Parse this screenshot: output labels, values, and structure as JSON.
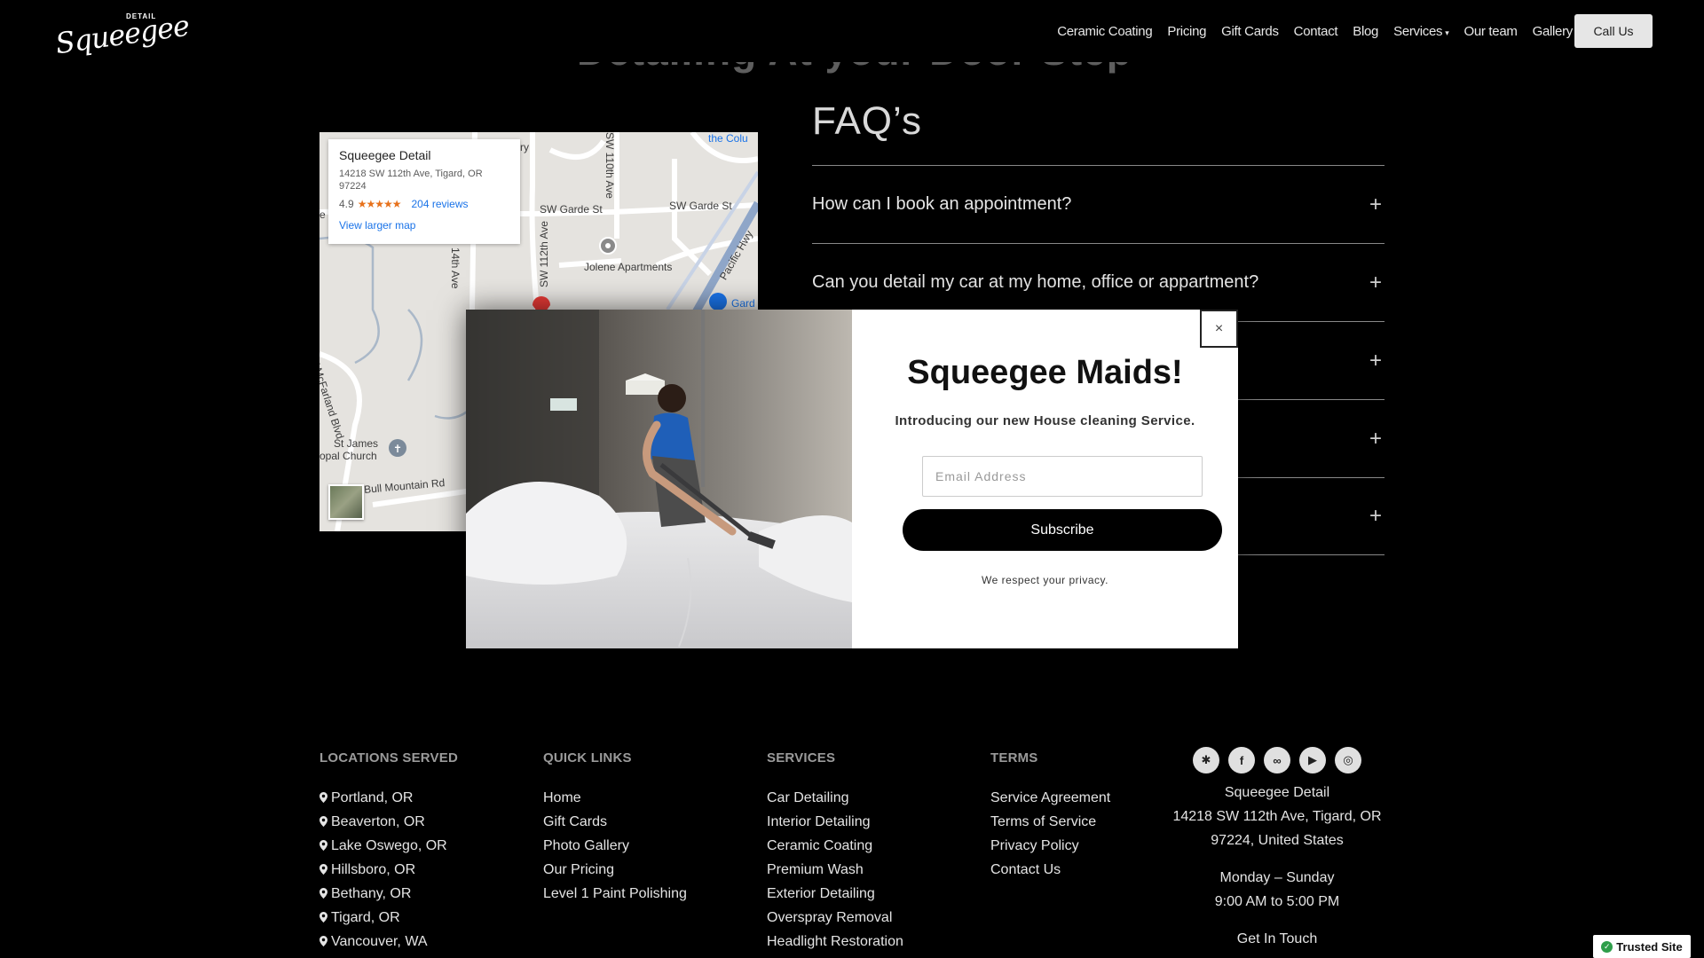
{
  "header": {
    "logo_text": "Squeegee",
    "logo_sub": "DETAIL",
    "nav": [
      "Ceramic Coating",
      "Pricing",
      "Gift Cards",
      "Contact",
      "Blog",
      "Services",
      "Our team",
      "Gallery"
    ],
    "call_label": "Call Us"
  },
  "partial_heading": "Detailing At your Door Step",
  "map": {
    "business_name": "Squeegee Detail",
    "address": "14218 SW 112th Ave, Tigard, OR 97224",
    "rating": "4.9",
    "stars": "★★★★★",
    "reviews": "204 reviews",
    "larger_map": "View larger map",
    "labels": {
      "garde1": "SW Garde St",
      "garde2": "SW Garde St",
      "jolene": "Jolene Apartments",
      "ave110": "SW 110th Ave",
      "ave112": "SW 112th Ave",
      "ave114": "14th Ave",
      "pacific": "Pacific Hwy",
      "mcfarland": "W McFarland Blvd",
      "stjames1": "St James",
      "stjames2": "opal Church",
      "bull": "Bull Mountain Rd",
      "colum": "the Colu",
      "gard": "Gard",
      "ry": "ry",
      "e": "e"
    }
  },
  "faq": {
    "title": "FAQ’s",
    "items": [
      "How can I book an appointment?",
      "Can you detail my car at my home, office or appartment?",
      "",
      "",
      ""
    ]
  },
  "modal": {
    "title": "Squeegee Maids!",
    "subtitle": "Introducing our new House cleaning Service.",
    "email_placeholder": "Email Address",
    "subscribe_label": "Subscribe",
    "privacy": "We respect your privacy.",
    "close_symbol": "×"
  },
  "footer": {
    "locations": {
      "heading": "LOCATIONS SERVED",
      "items": [
        "Portland, OR",
        "Beaverton, OR",
        "Lake Oswego, OR",
        "Hillsboro, OR",
        "Bethany, OR",
        "Tigard, OR",
        "Vancouver, WA"
      ]
    },
    "quick_links": {
      "heading": "QUICK LINKS",
      "items": [
        "Home",
        "Gift Cards",
        "Photo Gallery",
        "Our Pricing",
        "Level 1 Paint Polishing"
      ]
    },
    "services": {
      "heading": "SERVICES",
      "items": [
        "Car Detailing",
        "Interior Detailing",
        "Ceramic Coating",
        "Premium Wash",
        "Exterior Detailing",
        "Overspray Removal",
        "Headlight Restoration"
      ]
    },
    "terms": {
      "heading": "TERMS",
      "items": [
        "Service Agreement",
        "Terms of Service",
        "Privacy Policy",
        "Contact Us"
      ]
    },
    "contact": {
      "socials": [
        "yelp-icon",
        "facebook-icon",
        "link-icon",
        "youtube-icon",
        "instagram-icon"
      ],
      "name": "Squeegee Detail",
      "address1": "14218 SW 112th Ave, Tigard, OR",
      "address2": "97224, United States",
      "days": "Monday – Sunday",
      "hours": "9:00 AM to 5:00 PM",
      "get_in_touch": "Get In Touch"
    }
  },
  "trusted": "Trusted Site"
}
